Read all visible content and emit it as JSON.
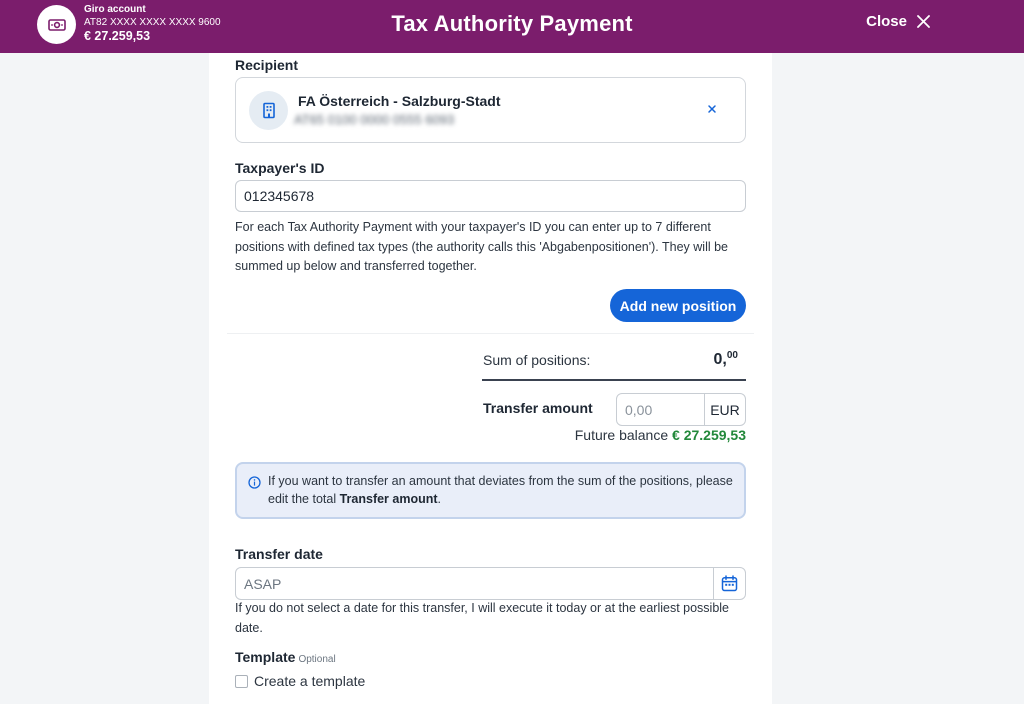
{
  "account": {
    "name": "Giro account",
    "iban": "AT82 XXXX XXXX XXXX 9600",
    "balance": "€ 27.259,53",
    "icon": "banknote-icon"
  },
  "header": {
    "title": "Tax Authority Payment",
    "close_label": "Close",
    "brand_color": "#7b1d6c"
  },
  "recipient": {
    "label": "Recipient",
    "name": "FA Österreich - Salzburg-Stadt",
    "iban_blurred": "AT65 0100 0000 0555 6093",
    "icon": "bank-building-icon"
  },
  "taxpayer": {
    "label": "Taxpayer's ID",
    "value": "012345678",
    "info": "For each Tax Authority Payment with your taxpayer's ID you can enter up to 7 different positions with defined tax types (the authority calls this 'Abgabenpositionen'). They will be summed up below and transferred together."
  },
  "add_position_label": "Add new position",
  "sum": {
    "label": "Sum of positions:",
    "value_int": "0,",
    "value_dec": "00"
  },
  "transfer_amount": {
    "label": "Transfer amount",
    "placeholder": "0,00",
    "currency": "EUR"
  },
  "future_balance": {
    "label": "Future balance",
    "value": "€ 27.259,53",
    "color": "#22883a"
  },
  "notice": {
    "text_before": "If you want to transfer an amount that deviates from the sum of the positions, please edit the total",
    "text_bold": "Transfer amount",
    "text_after": "."
  },
  "transfer_date": {
    "label": "Transfer date",
    "placeholder": "ASAP",
    "info": "If you do not select a date for this transfer, I will execute it today or at the earliest possible date."
  },
  "template": {
    "label": "Template",
    "optional": "Optional",
    "checkbox_label": "Create a template",
    "checked": false
  },
  "accent_color": "#1565d8"
}
